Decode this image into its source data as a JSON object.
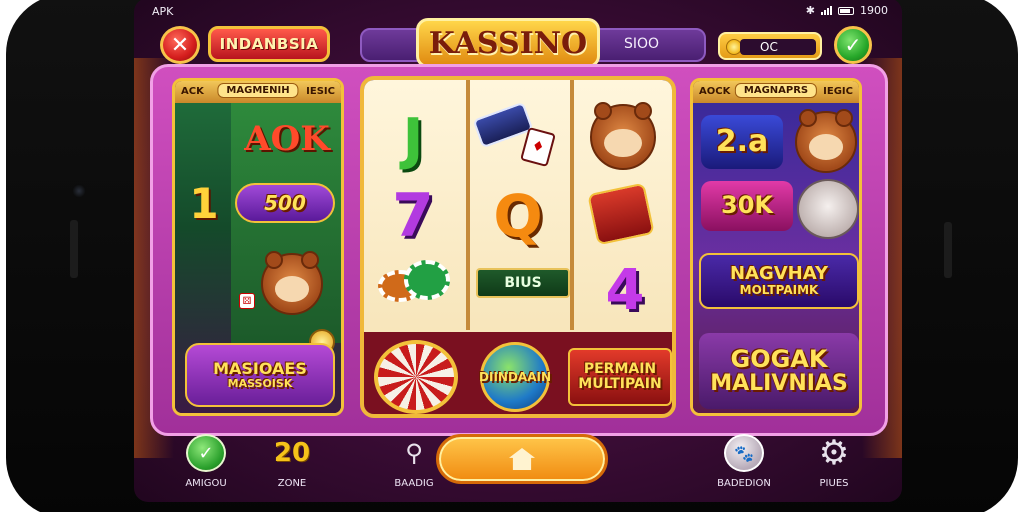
{
  "status_bar": {
    "left_text": "APK",
    "right_text": "1900"
  },
  "header": {
    "close_icon": "close-icon",
    "brand": "INDANBSIA",
    "title": "KASSINO",
    "bet_value": "SIOO",
    "coin_value": "OC",
    "confirm_icon": "check-icon"
  },
  "panels": {
    "left": {
      "header_left": "ACK",
      "header_center": "MAGMENIH",
      "header_right": "IESIC",
      "symbols": [
        "AOK",
        "1",
        "500",
        "MASIOAES",
        "MASSOISK"
      ]
    },
    "middle": {
      "symbols": [
        "J",
        "7",
        "Q",
        "4"
      ],
      "bonus_label": "BIUS",
      "bottom_tiles": [
        "DIINDAAIN",
        "PERMAIN",
        "MULTIPAIN"
      ]
    },
    "right": {
      "header_left": "AOCK",
      "header_center": "MAGNAPRS",
      "header_right": "IEGIC",
      "symbols": [
        "2.a",
        "30K",
        "NAGVHAY",
        "MOLTPAIMK",
        "GOGAK",
        "MALIVNIAS"
      ]
    }
  },
  "bottom_nav": {
    "items": [
      {
        "label": "AMIGOU",
        "icon": "check-icon"
      },
      {
        "label": "ZONE",
        "icon": "gold-zone-icon",
        "glyph": "20"
      },
      {
        "label": "BAADIG",
        "icon": "tool-icon"
      },
      {
        "label": "BADEDION",
        "icon": "pet-icon"
      },
      {
        "label": "PIUES",
        "icon": "gear-icon"
      }
    ],
    "spin_button_icon": "home-icon"
  },
  "colors": {
    "frame": "#c443b4",
    "gold": "#f3c13a",
    "background": "#3a0c35",
    "spin": "#f7a72a"
  }
}
